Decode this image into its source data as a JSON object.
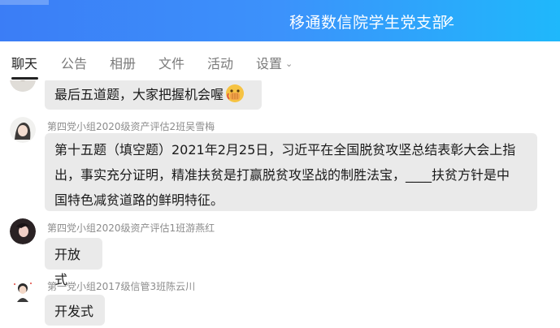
{
  "header": {
    "title": "移通数信院学生党支部",
    "edit_icon": "pencil-icon",
    "gradient_start": "#3b7df6",
    "gradient_end": "#1fb8fb"
  },
  "tabs": [
    {
      "label": "聊天",
      "active": true
    },
    {
      "label": "公告",
      "active": false
    },
    {
      "label": "相册",
      "active": false
    },
    {
      "label": "文件",
      "active": false
    },
    {
      "label": "活动",
      "active": false
    },
    {
      "label": "设置",
      "active": false,
      "has_dropdown": true
    }
  ],
  "messages": [
    {
      "sender": "",
      "text": "最后五道题，大家把握机会喔",
      "emoji": "fist-face-emoji"
    },
    {
      "sender": "第四党小组2020级资产评估2班吴雪梅",
      "lines": [
        "第十五题（填空题）2021年2月25日，习近平在全国脱贫攻坚总结表彰大会上指",
        "出，事实充分证明，精准扶贫是打赢脱贫攻坚战的制胜法宝，____扶贫方针是中",
        "国特色减贫道路的鲜明特征。"
      ]
    },
    {
      "sender": "第四党小组2020级资产评估1班游燕红",
      "text": "开放式"
    },
    {
      "sender": "第一党小组2017级信管3班陈云川",
      "text": "开发式"
    }
  ],
  "colors": {
    "bubble_bg": "#eaeaea",
    "sender_text": "#8c8c8c",
    "tab_inactive": "#7a7a7a",
    "tab_active": "#222222"
  }
}
